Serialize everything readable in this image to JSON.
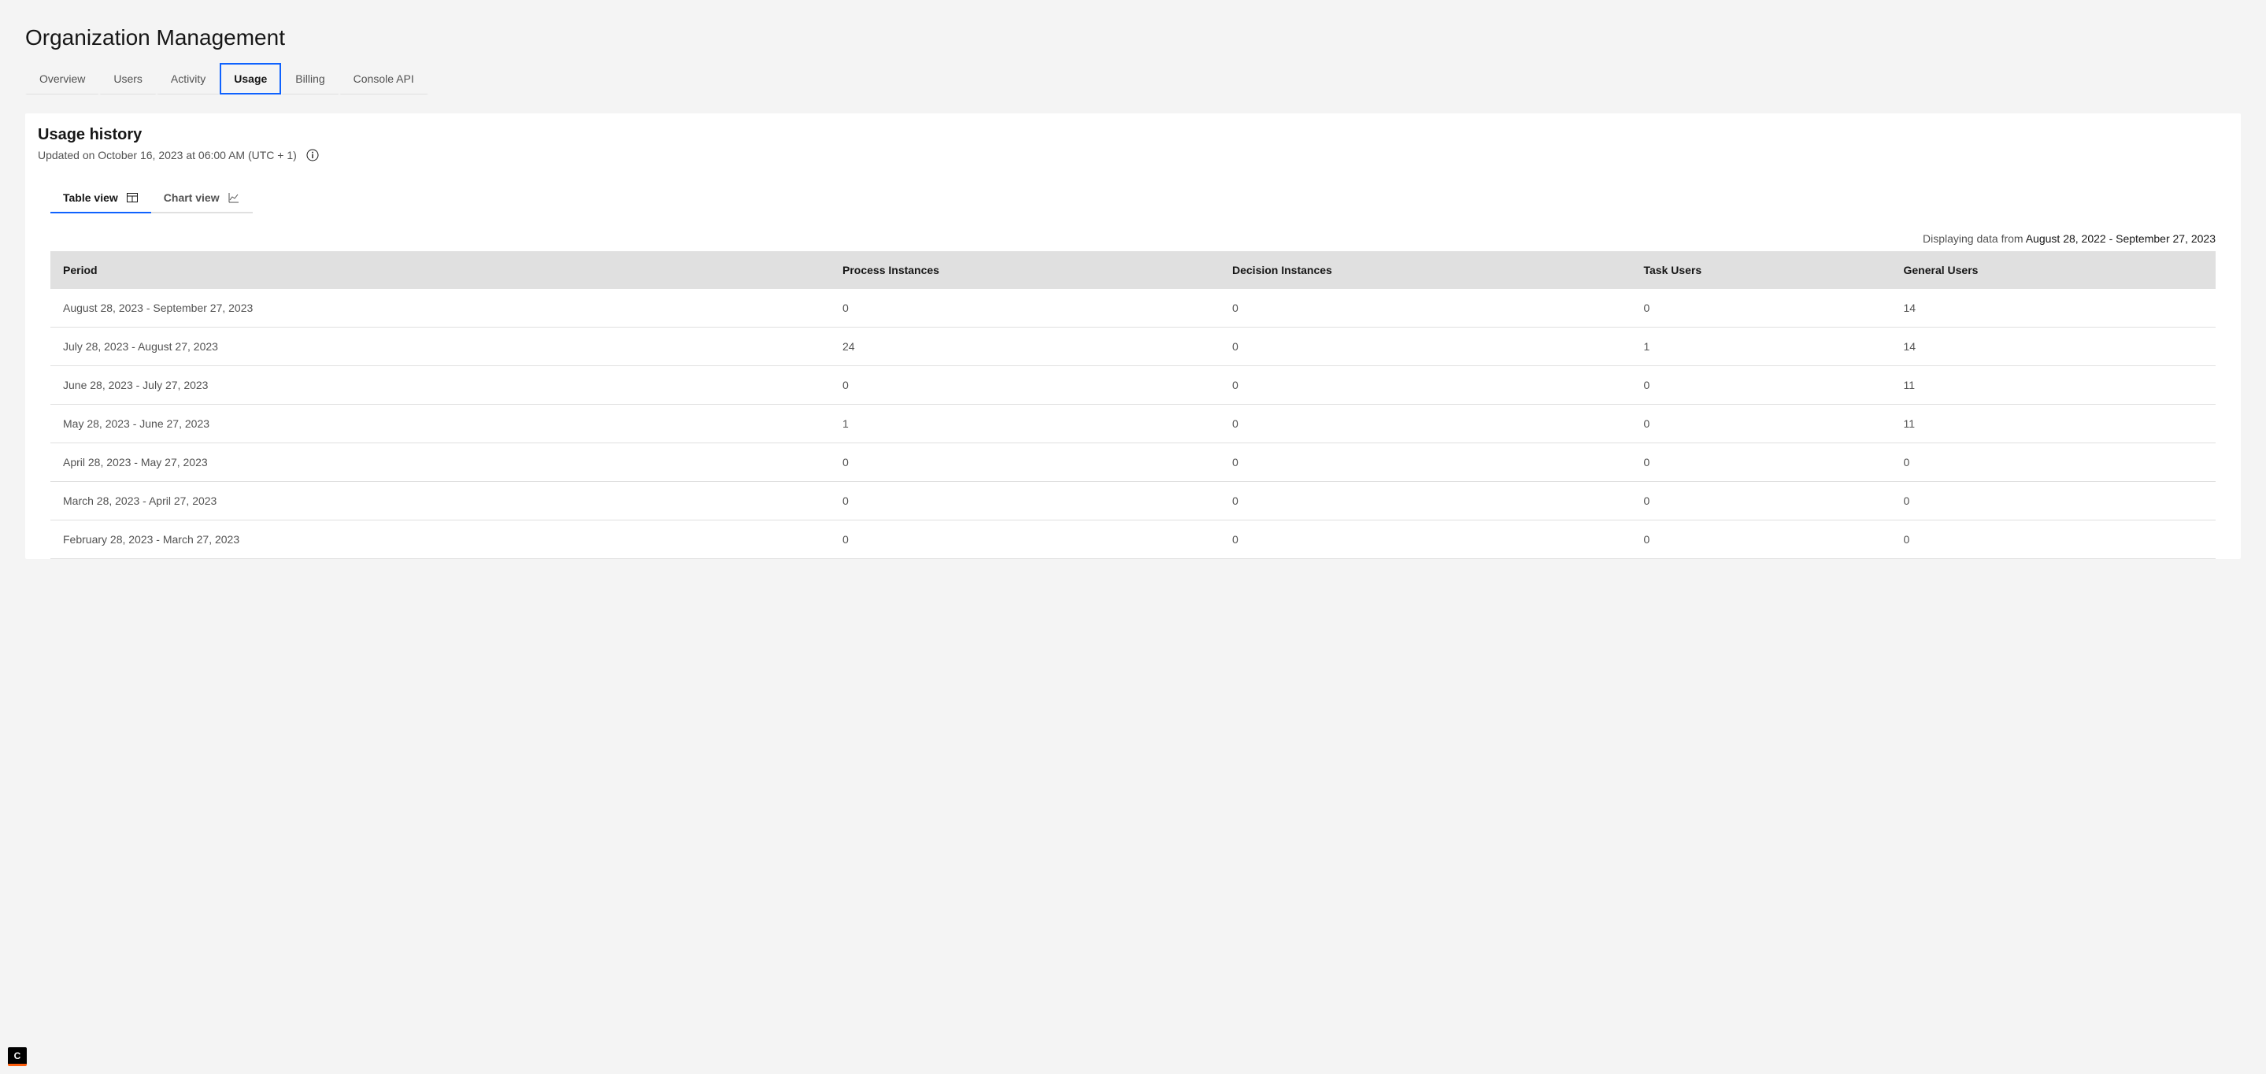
{
  "page": {
    "title": "Organization Management"
  },
  "main_tabs": {
    "overview": "Overview",
    "users": "Users",
    "activity": "Activity",
    "usage": "Usage",
    "billing": "Billing",
    "console_api": "Console API"
  },
  "card": {
    "title": "Usage history",
    "subtitle": "Updated on October 16, 2023 at 06:00 AM (UTC + 1)"
  },
  "sub_tabs": {
    "table_view": "Table view",
    "chart_view": "Chart view"
  },
  "data_range": {
    "prefix": "Displaying data from ",
    "dates": "August 28, 2022 - September 27, 2023"
  },
  "table": {
    "headers": {
      "period": "Period",
      "process_instances": "Process Instances",
      "decision_instances": "Decision Instances",
      "task_users": "Task Users",
      "general_users": "General Users"
    },
    "rows": [
      {
        "period": "August 28, 2023 - September 27, 2023",
        "process_instances": "0",
        "decision_instances": "0",
        "task_users": "0",
        "general_users": "14"
      },
      {
        "period": "July 28, 2023 - August 27, 2023",
        "process_instances": "24",
        "decision_instances": "0",
        "task_users": "1",
        "general_users": "14"
      },
      {
        "period": "June 28, 2023 - July 27, 2023",
        "process_instances": "0",
        "decision_instances": "0",
        "task_users": "0",
        "general_users": "11"
      },
      {
        "period": "May 28, 2023 - June 27, 2023",
        "process_instances": "1",
        "decision_instances": "0",
        "task_users": "0",
        "general_users": "11"
      },
      {
        "period": "April 28, 2023 - May 27, 2023",
        "process_instances": "0",
        "decision_instances": "0",
        "task_users": "0",
        "general_users": "0"
      },
      {
        "period": "March 28, 2023 - April 27, 2023",
        "process_instances": "0",
        "decision_instances": "0",
        "task_users": "0",
        "general_users": "0"
      },
      {
        "period": "February 28, 2023 - March 27, 2023",
        "process_instances": "0",
        "decision_instances": "0",
        "task_users": "0",
        "general_users": "0"
      }
    ]
  },
  "badge": {
    "letter": "C"
  }
}
